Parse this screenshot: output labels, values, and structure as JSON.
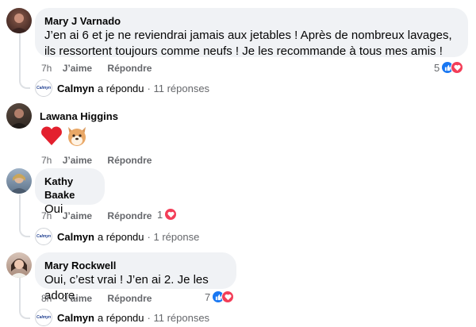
{
  "comments": [
    {
      "author": "Mary J Varnado",
      "text": "J’en ai 6 et je ne reviendrai jamais aux jetables ! Après de nombreux lavages, ils ressortent toujours comme neufs ! Je les recommande à tous mes amis !",
      "time": "7h",
      "like_label": "J’aime",
      "reply_label": "Répondre",
      "reaction_count": "5",
      "reactions": [
        "like-icon",
        "love-icon"
      ],
      "replies": {
        "name": "Calmyn",
        "verb": "a répondu",
        "count": "· 11 réponses"
      }
    },
    {
      "author": "Lawana Higgins",
      "emojis": [
        "heart-emoji",
        "dog-face-emoji"
      ],
      "time": "7h",
      "like_label": "J’aime",
      "reply_label": "Répondre"
    },
    {
      "author": "Kathy Baake",
      "text": "Oui",
      "time": "7h",
      "like_label": "J’aime",
      "reply_label": "Répondre",
      "reaction_count": "1",
      "reactions": [
        "love-icon"
      ],
      "replies": {
        "name": "Calmyn",
        "verb": "a répondu",
        "count": "· 1 réponse"
      }
    },
    {
      "author": "Mary Rockwell",
      "text": "Oui, c’est vrai ! J’en ai 2. Je les adore.",
      "time": "8h",
      "like_label": "J’aime",
      "reply_label": "Répondre",
      "reaction_count": "7",
      "reactions": [
        "like-icon",
        "love-icon"
      ],
      "replies": {
        "name": "Calmyn",
        "verb": "a répondu",
        "count": "· 11 réponses"
      }
    }
  ],
  "reply_logo_text": "Calmyn",
  "colors": {
    "like": "#1877f2",
    "love": "#f33e58",
    "bubble": "#f0f2f5",
    "meta": "#65676b"
  }
}
